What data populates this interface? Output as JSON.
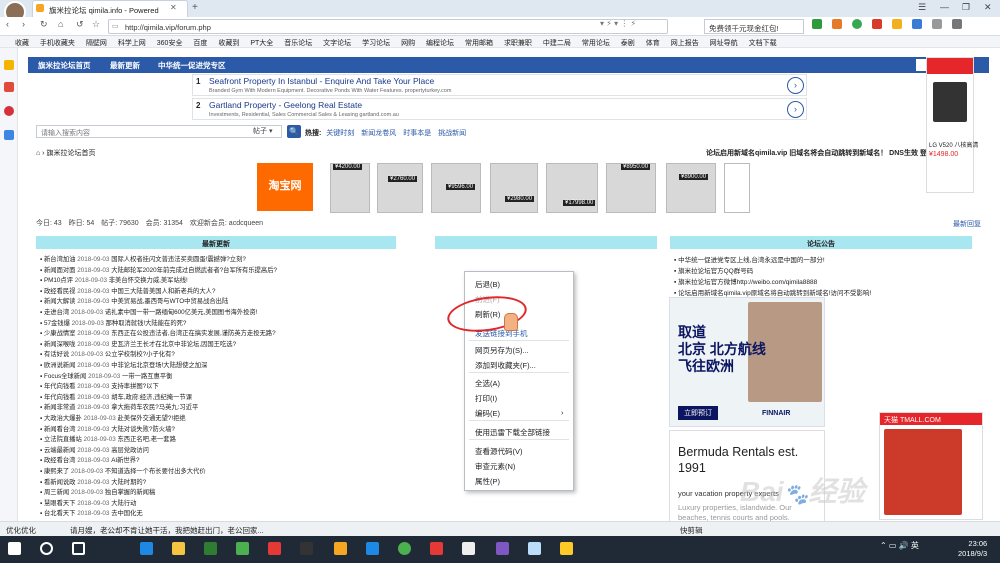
{
  "browser": {
    "tab_title": "旗米拉论坛 qimila.info - Powered",
    "address": "http://qimila.vip/forum.php",
    "search_text": "免费领千元现金红包!",
    "favorites": [
      "收藏",
      "手机收藏夹",
      "隔壁网",
      "科学上网",
      "360安全",
      "百度",
      "收藏到",
      "PT大全",
      "音乐论坛",
      "文字论坛",
      "学习论坛",
      "网购",
      "编程论坛",
      "常用邮箱",
      "求职兼职",
      "中建二局",
      "常用论坛",
      "泰剧",
      "体育",
      "网上报告",
      "网址导航",
      "文档下载"
    ]
  },
  "site": {
    "nav": [
      "旗米拉论坛首页",
      "最新更新",
      "中华统一促进党专区"
    ],
    "ads": [
      {
        "num": "1",
        "title": "Seafront Property In Istanbul - Enquire And Take Your Place",
        "sub": "Branded Gym With Modern Equipment. Decorative Ponds With Water Features. propertyturkey.com"
      },
      {
        "num": "2",
        "title": "Gartland Property - Geelong Real Estate",
        "sub": "Investments, Residential, Sales Commercial Sales & Leasing gartland.com.au"
      }
    ],
    "search_placeholder": "请输入搜索内容",
    "search_select": "帖子",
    "search_btn": "🔍",
    "hot_label": "热搜:",
    "hot_terms": [
      "关键时刻",
      "新闻龙卷风",
      "时事本是",
      "挑战新闻"
    ],
    "breadcrumb": "旗米拉论坛首页",
    "notice": "论坛启用新域名qimila.vip 旧域名将会自动跳转到新域名！ DNS生效 登录 我们会",
    "taobao": "淘宝网",
    "prices": [
      "¥4200.00",
      "¥2760.00",
      "¥9596.00",
      "¥2980.00",
      "¥17998.00",
      "¥8950.00",
      "¥8900.00"
    ],
    "stats": [
      "今日: 43",
      "昨日: 54",
      "帖子: 79630",
      "会员: 31354",
      "欢迎新会员: acdcqueen"
    ],
    "all_read": "最新回复",
    "col_left": "最新更新",
    "col_right": "论坛公告",
    "news": [
      [
        "新台湾加油",
        "2018-09-03",
        "国际人权者挂闪文普违法买卖圆蛋!震撼弹?立刻?"
      ],
      [
        "新闻面对面",
        "2018-09-03",
        "大陆邮轮军2020年前完成过自燃武者者?台军所有乐提高后?"
      ],
      [
        "PM10点评",
        "2018-09-03",
        "非美台怀交换力威,美军站线!"
      ],
      [
        "政经看民视",
        "2018-09-03",
        "中国三大陆普美国人和新老兵的大人?"
      ],
      [
        "新闻大解读",
        "2018-09-03",
        "中美贸易战,墨西哥与WTO中贸易战合出陆"
      ],
      [
        "走进台湾",
        "2018-09-03",
        "诺扎素中国一带一路缅甸600亿美元,美国图书海外投资!"
      ],
      [
        "57金钱爆",
        "2018-09-03",
        "那种取消就钱!大陆能在的死?"
      ],
      [
        "少康战情室",
        "2018-09-03",
        "东西正在公投违法者,台湾正在搞实发展,谨防英方走投无路?"
      ],
      [
        "新闻深喉咙",
        "2018-09-03",
        "史瓦济兰王长才在北京中非论坛,因国王吃选?"
      ],
      [
        "有话好说",
        "2018-09-03",
        "公立学校制校?小子化有?"
      ],
      [
        "欧洲说新闻",
        "2018-09-03",
        "中非论坛北京登场!大陆想使之加深"
      ],
      [
        "Focus全球新闻",
        "2018-09-03",
        "一带一路互惠平衡"
      ],
      [
        "年代向钱看",
        "2018-09-03",
        "支持率拼图?以下"
      ],
      [
        "年代向钱看",
        "2018-09-03",
        "胡车,政府:经济,违纪掩一节课"
      ],
      [
        "新闻非常道",
        "2018-09-03",
        "拿大拖荷车农民?马英九:习近平"
      ],
      [
        "大政治大爆卦",
        "2018-09-03",
        "赴美保外交通无望?!拒绝"
      ],
      [
        "新闻看台湾",
        "2018-09-03",
        "大陆对谈失败?防火墙?"
      ],
      [
        "立法院直播站",
        "2018-09-03",
        "东西正名吧,老一套路"
      ],
      [
        "云端最新闻",
        "2018-09-03",
        "高层党政访问"
      ],
      [
        "政经看台湾",
        "2018-09-03",
        "AI新世界?"
      ],
      [
        "康熙来了",
        "2018-09-03",
        "不知道选择一个布长要付出多大代价"
      ],
      [
        "看新闻说政",
        "2018-09-03",
        "大陆时期的?"
      ],
      [
        "周三新闻",
        "2018-09-03",
        "独自掌握的新闻稿"
      ],
      [
        "慧眼看天下",
        "2018-09-03",
        "大陆行动"
      ],
      [
        "台北看天下",
        "2018-09-03",
        "去中国化无"
      ]
    ],
    "notices": [
      "中华统一促进党专区上线,台湾永远是中国的一部分!",
      "旗米拉论坛官方QQ群号码",
      "旗米拉论坛官方微博http://weibo.com/qimila8888",
      "论坛启用新域名qimila.vip原域名将自动跳转到新域名!访问不受影响!"
    ],
    "finnair": {
      "headline": "取道\n北京 北方航线\n飞往欧洲",
      "btn": "立即预订",
      "logo": "FINNAIR"
    },
    "bermuda": {
      "headline": "Bermuda Rentals est. 1991",
      "p": "your vacation property experts",
      "q": "Luxury properties, islandwide. Our beaches, tennis courts and pools."
    },
    "rightad": {
      "title": "LG V520 八核高清",
      "price": "¥1498.00"
    },
    "tmall": "天猫 TMALL.COM"
  },
  "context_menu": {
    "items": [
      "后退(B)",
      "前进(F)",
      "刷新(R)",
      "发送链接到手机",
      "网页另存为(S)...",
      "添加到收藏夹(F)...",
      "全选(A)",
      "打印(I)",
      "编码(E)",
      "使用迅雷下载全部链接",
      "查看源代码(V)",
      "审查元素(N)",
      "属性(P)"
    ]
  },
  "status_bar": {
    "text": "优化优化",
    "news": "请月嫂，老公却不肯让她干活，我把她赶出门，老公回家...",
    "right": "快剪辑"
  },
  "taskbar": {
    "time": "23:06",
    "date": "2018/9/3",
    "lang": "英"
  }
}
